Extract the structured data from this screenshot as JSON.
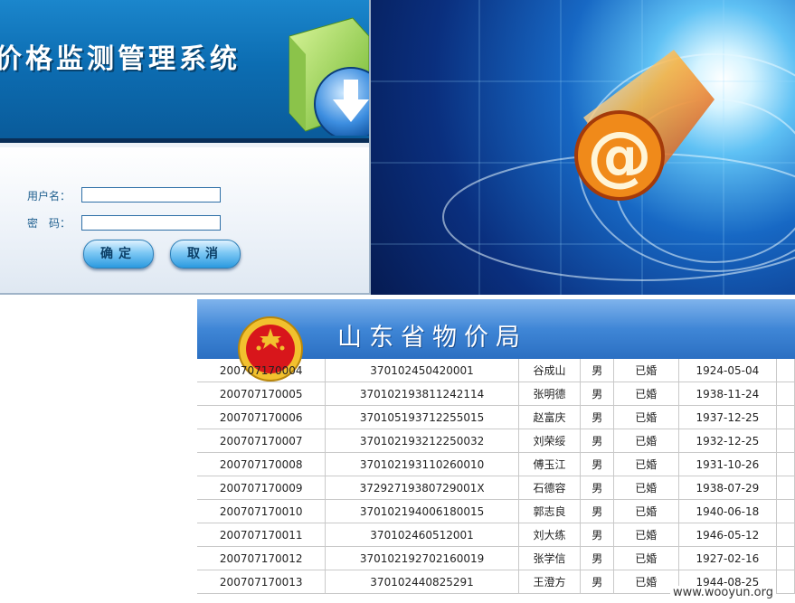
{
  "login": {
    "system_title": "价格监测管理系统",
    "username_label": "用户名：",
    "password_label": "密　码：",
    "username_value": "",
    "password_value": "",
    "confirm_label": "确定",
    "cancel_label": "取消"
  },
  "bureau": {
    "title": "山东省物价局"
  },
  "records": [
    {
      "id": "200707170004",
      "id_number": "370102450420001",
      "name": "谷成山",
      "gender": "男",
      "marital": "已婚",
      "birth": "1924-05-04"
    },
    {
      "id": "200707170005",
      "id_number": "370102193811242114",
      "name": "张明德",
      "gender": "男",
      "marital": "已婚",
      "birth": "1938-11-24"
    },
    {
      "id": "200707170006",
      "id_number": "370105193712255015",
      "name": "赵富庆",
      "gender": "男",
      "marital": "已婚",
      "birth": "1937-12-25"
    },
    {
      "id": "200707170007",
      "id_number": "370102193212250032",
      "name": "刘荣绥",
      "gender": "男",
      "marital": "已婚",
      "birth": "1932-12-25"
    },
    {
      "id": "200707170008",
      "id_number": "370102193110260010",
      "name": "傅玉江",
      "gender": "男",
      "marital": "已婚",
      "birth": "1931-10-26"
    },
    {
      "id": "200707170009",
      "id_number": "37292719380729001X",
      "name": "石德容",
      "gender": "男",
      "marital": "已婚",
      "birth": "1938-07-29"
    },
    {
      "id": "200707170010",
      "id_number": "370102194006180015",
      "name": "郭志良",
      "gender": "男",
      "marital": "已婚",
      "birth": "1940-06-18"
    },
    {
      "id": "200707170011",
      "id_number": "370102460512001",
      "name": "刘大练",
      "gender": "男",
      "marital": "已婚",
      "birth": "1946-05-12"
    },
    {
      "id": "200707170012",
      "id_number": "370102192702160019",
      "name": "张学信",
      "gender": "男",
      "marital": "已婚",
      "birth": "1927-02-16"
    },
    {
      "id": "200707170013",
      "id_number": "370102440825291",
      "name": "王澄方",
      "gender": "男",
      "marital": "已婚",
      "birth": "1944-08-25"
    }
  ],
  "watermark": "www.wooyun.org",
  "colors": {
    "banner_blue": "#0c6db2",
    "bureau_blue": "#3f86d6",
    "button_blue": "#2b9ae0",
    "emblem_red": "#d8161b",
    "emblem_gold": "#f2c12e"
  },
  "icons": {
    "folder": "folder-download-icon",
    "at_sign": "at-sign-icon",
    "emblem": "national-emblem-icon"
  }
}
